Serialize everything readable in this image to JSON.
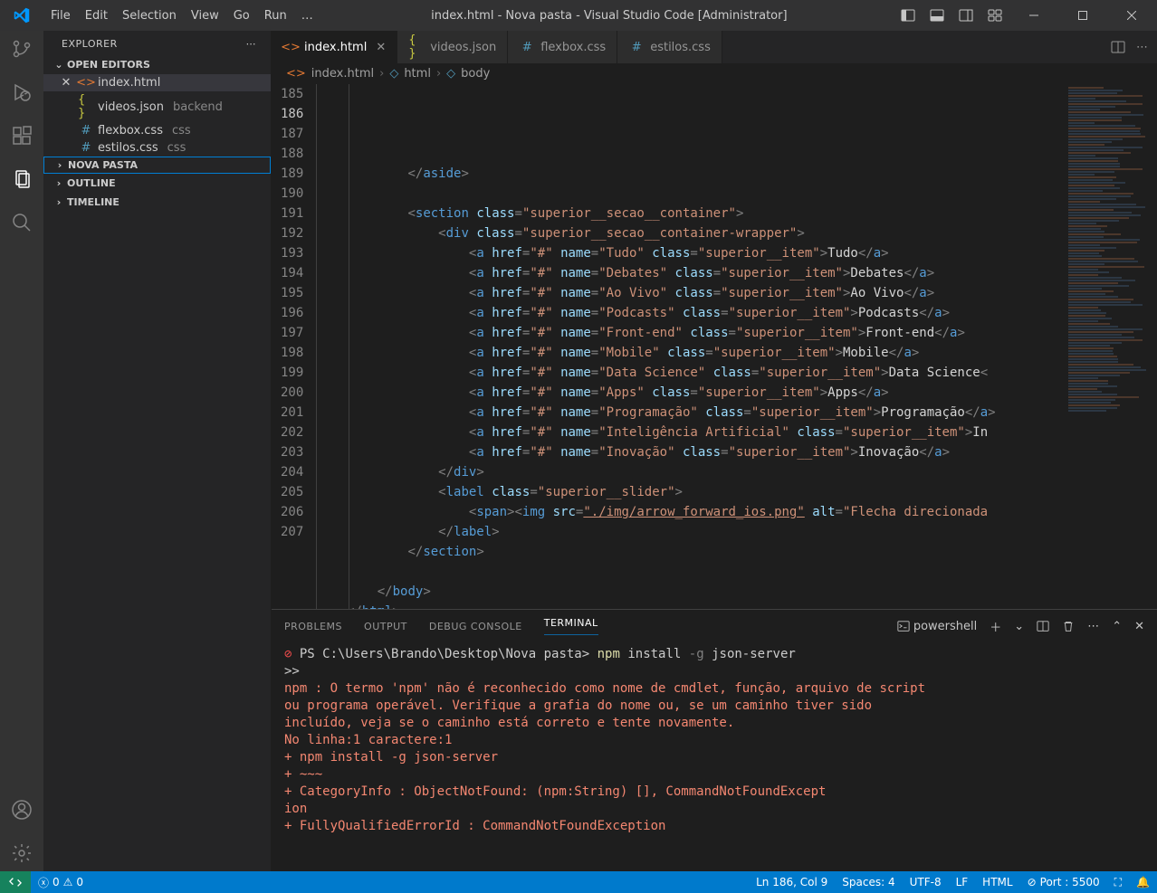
{
  "titlebar": {
    "menu": [
      "File",
      "Edit",
      "Selection",
      "View",
      "Go",
      "Run",
      "…"
    ],
    "title": "index.html - Nova pasta - Visual Studio Code [Administrator]"
  },
  "sidebar": {
    "title": "EXPLORER",
    "openEditorsLabel": "OPEN EDITORS",
    "folderLabel": "NOVA PASTA",
    "outlineLabel": "OUTLINE",
    "timelineLabel": "TIMELINE",
    "openEditors": [
      {
        "name": "index.html",
        "badge": "",
        "close": "✕",
        "active": true,
        "kind": "html"
      },
      {
        "name": "videos.json",
        "badge": "backend",
        "close": "",
        "kind": "json"
      },
      {
        "name": "flexbox.css",
        "badge": "css",
        "close": "",
        "kind": "css"
      },
      {
        "name": "estilos.css",
        "badge": "css",
        "close": "",
        "kind": "css"
      }
    ]
  },
  "tabs": [
    {
      "name": "index.html",
      "kind": "html",
      "active": true,
      "close": true
    },
    {
      "name": "videos.json",
      "kind": "json"
    },
    {
      "name": "flexbox.css",
      "kind": "css"
    },
    {
      "name": "estilos.css",
      "kind": "css"
    }
  ],
  "breadcrumb": {
    "file": "index.html",
    "el1": "html",
    "el2": "body"
  },
  "lines": {
    "start": 185,
    "current": 186,
    "end": 207
  },
  "code": {
    "l185": {
      "ind": 3,
      "type": "closetag",
      "tag": "aside"
    },
    "l186": {
      "ind": 0,
      "type": "blank"
    },
    "l187": {
      "ind": 3,
      "type": "opentag",
      "tag": "section",
      "attr": "class",
      "val": "superior__secao__container"
    },
    "l188": {
      "ind": 4,
      "type": "opentag",
      "tag": "div",
      "attr": "class",
      "val": "superior__secao__container-wrapper"
    },
    "l189": {
      "ind": 5,
      "link": "Tudo"
    },
    "l190": {
      "ind": 5,
      "link": "Debates"
    },
    "l191": {
      "ind": 5,
      "link": "Ao Vivo"
    },
    "l192": {
      "ind": 5,
      "link": "Podcasts"
    },
    "l193": {
      "ind": 5,
      "link": "Front-end"
    },
    "l194": {
      "ind": 5,
      "link": "Mobile"
    },
    "l195": {
      "ind": 5,
      "link": "Data Science",
      "trunc": true
    },
    "l196": {
      "ind": 5,
      "link": "Apps"
    },
    "l197": {
      "ind": 5,
      "link": "Programação"
    },
    "l198": {
      "ind": 5,
      "link": "Inteligência Artificial",
      "txt": "In",
      "trunc": true
    },
    "l199": {
      "ind": 5,
      "link": "Inovação"
    },
    "l200": {
      "ind": 4,
      "type": "closetag",
      "tag": "div"
    },
    "l201": {
      "ind": 4,
      "type": "opentag",
      "tag": "label",
      "attr": "class",
      "val": "superior__slider"
    },
    "l202": {
      "ind": 5,
      "type": "img",
      "src": "./img/arrow_forward_ios.png",
      "alt": "Flecha direcionada"
    },
    "l203": {
      "ind": 4,
      "type": "closetag",
      "tag": "label"
    },
    "l204": {
      "ind": 3,
      "type": "closetag",
      "tag": "section"
    },
    "l205": {
      "ind": 0,
      "type": "blank"
    },
    "l206": {
      "ind": 2,
      "type": "closetag",
      "tag": "body"
    },
    "l207": {
      "ind": 1,
      "type": "closetag",
      "tag": "html"
    },
    "hrefVal": "#",
    "classVal": "superior__item"
  },
  "panel": {
    "tabs": {
      "problems": "PROBLEMS",
      "output": "OUTPUT",
      "debug": "DEBUG CONSOLE",
      "terminal": "TERMINAL"
    },
    "shell": "powershell",
    "prompt": "PS C:\\Users\\Brando\\Desktop\\Nova pasta>",
    "cmd": "npm",
    "cmdRest": "install",
    "flag": "-g",
    "pkg": "json-server",
    "prompt2": ">>",
    "err1": "npm : O termo 'npm' não é reconhecido como nome de cmdlet, função, arquivo de script",
    "err2": "ou programa operável. Verifique a grafia do nome ou, se um caminho tiver sido",
    "err3": "incluído, veja se o caminho está correto e tente novamente.",
    "err4": "No linha:1 caractere:1",
    "err5": "+ npm install -g json-server",
    "err6": "+ ~~~",
    "err7": "    + CategoryInfo          : ObjectNotFound: (npm:String) [], CommandNotFoundExcept",
    "err8": "ion",
    "err9": "    + FullyQualifiedErrorId : CommandNotFoundException"
  },
  "status": {
    "errors": "0",
    "warnings": "0",
    "lncol": "Ln 186, Col 9",
    "spaces": "Spaces: 4",
    "encoding": "UTF-8",
    "eol": "LF",
    "lang": "HTML",
    "port": "Port : 5500"
  }
}
